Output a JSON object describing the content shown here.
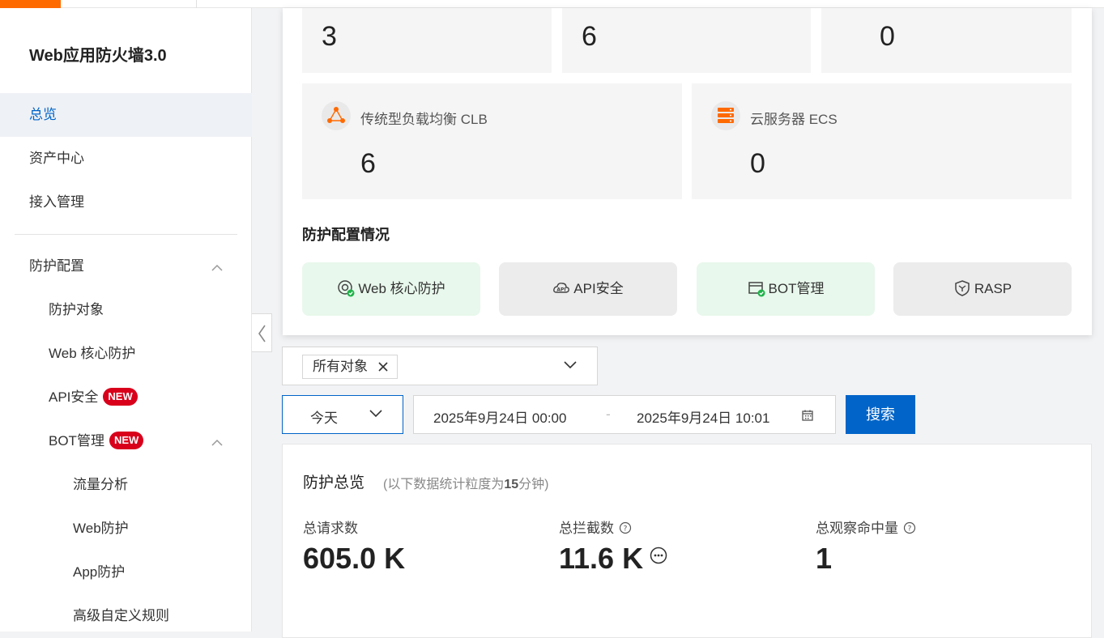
{
  "app": {
    "title": "Web应用防火墙3.0"
  },
  "sidebar": {
    "items": [
      {
        "label": "总览"
      },
      {
        "label": "资产中心"
      },
      {
        "label": "接入管理"
      },
      {
        "label": "防护配置"
      },
      {
        "label": "防护对象"
      },
      {
        "label": "Web 核心防护"
      },
      {
        "label": "API安全",
        "badge": "NEW"
      },
      {
        "label": "BOT管理",
        "badge": "NEW"
      },
      {
        "label": "流量分析"
      },
      {
        "label": "Web防护"
      },
      {
        "label": "App防护"
      },
      {
        "label": "高级自定义规则"
      }
    ]
  },
  "assets": {
    "top_counts": [
      "3",
      "6",
      "0"
    ],
    "clb": {
      "label": "传统型负载均衡 CLB",
      "count": "6"
    },
    "ecs": {
      "label": "云服务器 ECS",
      "count": "0"
    }
  },
  "protection_config": {
    "title": "防护配置情况",
    "modules": [
      {
        "label": "Web 核心防护",
        "enabled": true
      },
      {
        "label": "API安全",
        "enabled": false
      },
      {
        "label": "BOT管理",
        "enabled": true
      },
      {
        "label": "RASP",
        "enabled": false
      }
    ]
  },
  "filters": {
    "object_tag": "所有对象",
    "time_range": "今天",
    "start": "2025年9月24日 00:00",
    "separator": "-",
    "end": "2025年9月24日 10:01",
    "search_label": "搜索"
  },
  "overview": {
    "title": "防护总览",
    "subtitle_pre": "(以下数据统计粒度为",
    "subtitle_num": "15",
    "subtitle_post": "分钟)",
    "metrics": [
      {
        "label": "总请求数",
        "value": "605.0 K"
      },
      {
        "label": "总拦截数",
        "value": "11.6 K"
      },
      {
        "label": "总观察命中量",
        "value": "1"
      }
    ]
  },
  "colors": {
    "primary": "#0064c8",
    "accent": "#ff6a00",
    "badge": "#d9001b",
    "enabled_bg": "#e8f8ec",
    "disabled_bg": "#ececec"
  }
}
